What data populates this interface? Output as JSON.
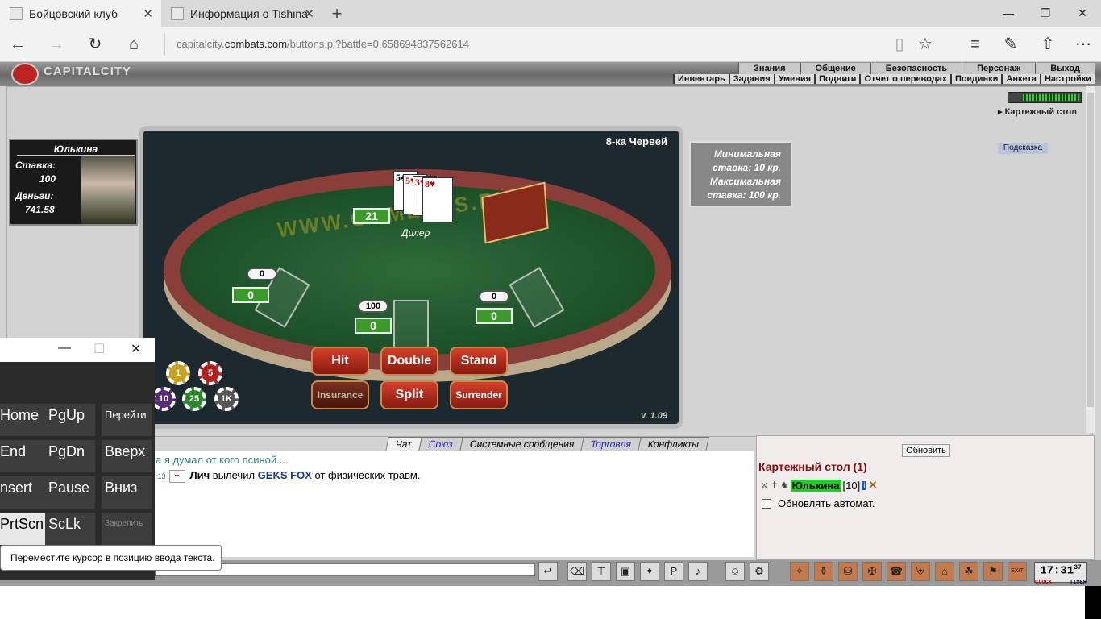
{
  "browser": {
    "tabs": [
      {
        "title": "Бойцовский клуб",
        "close": "✕"
      },
      {
        "title": "Информация о Tishina",
        "close": "✕"
      }
    ],
    "new_tab": "+",
    "window_controls": {
      "minimize": "—",
      "maximize": "❐",
      "close": "✕"
    },
    "nav": {
      "back": "←",
      "forward": "→",
      "refresh": "↻",
      "home": "⌂"
    },
    "address": {
      "prefix": "capitalcity.",
      "domain": "combats.com",
      "path": "/buttons.pl?battle=0.658694837562614"
    },
    "toolbar_icons": {
      "reading": "▯",
      "favorite": "☆",
      "hub": "≡",
      "note": "✎",
      "share": "⇧",
      "more": "⋯"
    }
  },
  "site": {
    "logo": "CAPITALCITY",
    "menu_top": [
      "Знания",
      "Общение",
      "Безопасность",
      "Персонаж",
      "Выход"
    ],
    "menu_bottom": [
      "Инвентарь",
      "Задания",
      "Умения",
      "Подвиги",
      "Отчет о переводах",
      "Поединки",
      "Анкета",
      "Настройки"
    ],
    "room_name": "Картежный стол",
    "hint_button": "Подсказка"
  },
  "player": {
    "name": "Юлькина",
    "stake_label": "Ставка:",
    "stake": "100",
    "money_label": "Деньги:",
    "money": "741.58"
  },
  "game": {
    "watermark": "WWW.COMBATS.RU",
    "hand_title": "8-ка Червей",
    "version": "v. 1.09",
    "dealer_label": "Дилер",
    "dealer_score": "21",
    "dealer_cards": [
      "5♣",
      "5♥",
      "3♥",
      "8♥"
    ],
    "seats": [
      {
        "bet": "0",
        "score": "0"
      },
      {
        "bet": "100",
        "score": "0"
      },
      {
        "bet": "0",
        "score": "0"
      }
    ],
    "buttons": {
      "hit": "Hit",
      "double": "Double",
      "stand": "Stand",
      "insurance": "Insurance",
      "split": "Split",
      "surrender": "Surrender"
    },
    "chips": [
      "1",
      "5",
      "10",
      "25",
      "1K"
    ],
    "limits": {
      "min_label": "Минимальная",
      "min_value": "ставка:   10 кр.",
      "max_label": "Максимальная",
      "max_value": "ставка:   100 кр."
    }
  },
  "chat": {
    "tabs": [
      "Чат",
      "Союз",
      "Системные сообщения",
      "Торговля",
      "Конфликты"
    ],
    "line1": "а я думал от кого псиной....",
    "line2_time": ":13",
    "line2_icon": "+",
    "line2_actor": "Лич",
    "line2_mid": " вылечил ",
    "line2_target": "GEKS FOX",
    "line2_end": " от физических травм."
  },
  "room_panel": {
    "refresh_button": "Обновить",
    "title": "Картежный стол (1)",
    "user_name": "Юлькина",
    "user_level": "[10]",
    "user_info": "i",
    "auto_refresh": "Обновлять автомат."
  },
  "bottom_toolbar": {
    "send": "↵",
    "clock_time": "17:31",
    "clock_sec": "37",
    "clock_label": "CLOCK",
    "timer_label": "TIMER",
    "exit_label": "EXIT"
  },
  "osk": {
    "title_controls": [
      "—",
      "☐",
      "✕"
    ],
    "keys": [
      [
        "Home",
        "PgUp",
        "Перейти"
      ],
      [
        "End",
        "PgDn",
        "Вверх"
      ],
      [
        "nsert",
        "Pause",
        "Вниз"
      ],
      [
        "PrtScn",
        "ScLk",
        "Закрепить"
      ]
    ],
    "tooltip": "Переместите курсор в позицию ввода текста."
  },
  "colors": {
    "felt": "#1b4f28",
    "rail": "#8a3e3a",
    "score_green": "#3a9a2a",
    "button_red": "#c0301e",
    "room_title": "#8a0a0a"
  }
}
